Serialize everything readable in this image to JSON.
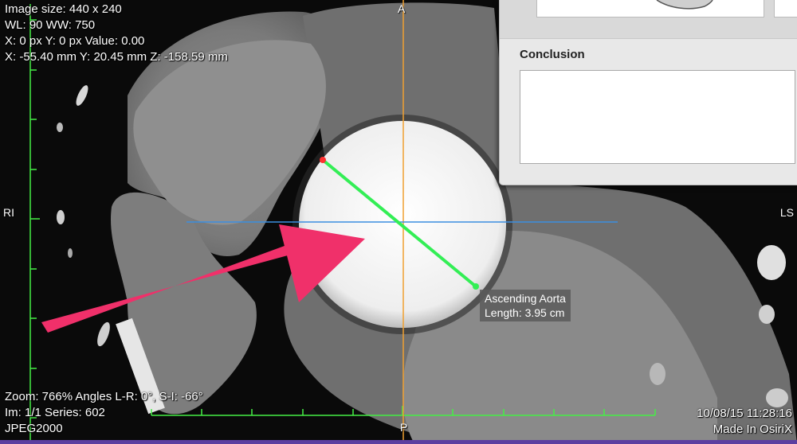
{
  "overlay": {
    "top_left": [
      "Image size: 440 x 240",
      "WL: 90 WW: 750",
      "X: 0 px Y: 0 px Value: 0.00",
      "X: -55.40 mm Y: 20.45 mm Z: -158.59 mm"
    ],
    "bottom_left": [
      "Zoom: 766% Angles L-R: 0°, S-I: -66°",
      "Im: 1/1  Series:  602",
      "JPEG2000"
    ],
    "bottom_right": [
      "10/08/15 11:28:16",
      "Made In OsiriX"
    ]
  },
  "orientation": {
    "top": "A",
    "bottom": "P",
    "left": "RI",
    "right": "LS"
  },
  "measurement": {
    "name": "Ascending Aorta",
    "length": "Length: 3.95 cm"
  },
  "report": {
    "conclusion_label": "Conclusion",
    "conclusion_value": ""
  },
  "colors": {
    "crosshair_vertical": "#f0a030",
    "crosshair_horizontal": "#3b8ee0",
    "ruler": "#44ee44",
    "measure_line": "#33ee55",
    "arrow": "#f0306a",
    "endpoint": "#ff3030"
  },
  "icons": [
    "arrow-annotation",
    "length-measurement-tool"
  ]
}
